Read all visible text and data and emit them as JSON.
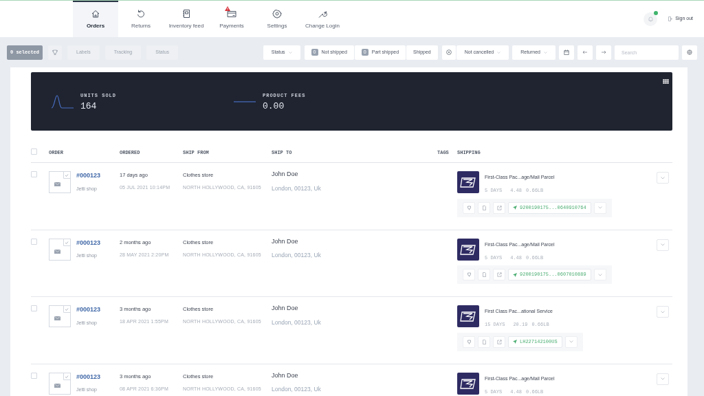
{
  "nav": [
    {
      "label": "Orders",
      "selected": true,
      "alert": false
    },
    {
      "label": "Returns",
      "selected": false,
      "alert": false
    },
    {
      "label": "Inventory feed",
      "selected": false,
      "alert": false
    },
    {
      "label": "Payments",
      "selected": false,
      "alert": true
    },
    {
      "label": "Settings",
      "selected": false,
      "alert": false
    },
    {
      "label": "Change Login",
      "selected": false,
      "alert": false
    }
  ],
  "notifications": {
    "unread": true
  },
  "sign_out": "Sign out",
  "toolbar": {
    "selected_count": "0 selected",
    "actions": [
      {
        "label": "Labels",
        "disabled": true
      },
      {
        "label": "Tracking",
        "disabled": true
      },
      {
        "label": "Status",
        "disabled": true
      }
    ],
    "status_filter": "Status",
    "shipment_filters": [
      {
        "count": "0",
        "label": "Not shipped"
      },
      {
        "count": "0",
        "label": "Part shipped"
      },
      {
        "label": "Shipped"
      }
    ],
    "cancel_filter": "Not cancelled",
    "return_filter": "Returned",
    "search": {
      "placeholder": "Search"
    }
  },
  "stats": [
    {
      "label": "UNITS SOLD",
      "value": "164",
      "kind": "peak"
    },
    {
      "label": "PRODUCT FEES",
      "value": "0.00",
      "kind": "flat"
    }
  ],
  "table": {
    "select_all": {
      "checked": false
    },
    "columns": [
      "ORDER",
      "ORDERED",
      "SHIP FROM",
      "SHIP TO",
      "TAGS",
      "SHIPPING"
    ],
    "rows": [
      {
        "checked": false,
        "order": "#000123",
        "shop": "Jetti shop",
        "ago": "17 days ago",
        "date": "05 JUL 2021 10:14PM",
        "from": "Clothes store",
        "from_address": "NORTH HOLLYWOOD, CA, 91605",
        "to": "John Doe",
        "to_address": "London, 00123, Uk",
        "service": "First-Class Pac...age/Mail Parcel",
        "days": "5 DAYS",
        "cost": "4.48",
        "weight": "0.66LB",
        "tracking": "9200190175...0640910764"
      },
      {
        "checked": false,
        "order": "#000123",
        "shop": "Jetti shop",
        "ago": "2 months ago",
        "date": "28 MAY 2021 2:20PM",
        "from": "Clothes store",
        "from_address": "NORTH HOLLYWOOD, CA, 91605",
        "to": "John Doe",
        "to_address": "London, 00123, Uk",
        "service": "First-Class Pac...age/Mail Parcel",
        "days": "5 DAYS",
        "cost": "4.48",
        "weight": "0.66LB",
        "tracking": "9200190175...0607010889"
      },
      {
        "checked": false,
        "order": "#000123",
        "shop": "Jetti shop",
        "ago": "3 months ago",
        "date": "18 APR 2021 1:55PM",
        "from": "Clothes store",
        "from_address": "NORTH HOLLYWOOD, CA, 91605",
        "to": "John Doe",
        "to_address": "London, 00123, Uk",
        "service": "First Class Pac...ational Service",
        "days": "15 DAYS",
        "cost": "20.19",
        "weight": "0.66LB",
        "tracking": "LH227142100US"
      },
      {
        "checked": false,
        "order": "#000123",
        "shop": "Jetti shop",
        "ago": "3 months ago",
        "date": "08 APR 2021 6:36PM",
        "from": "Clothes store",
        "from_address": "NORTH HOLLYWOOD, CA, 91605",
        "to": "John Doe",
        "to_address": "London, 00123, Uk",
        "service": "First-Class Pac...age/Mail Parcel",
        "days": "5 DAYS",
        "cost": "4.48",
        "weight": "0.66LB"
      }
    ]
  }
}
